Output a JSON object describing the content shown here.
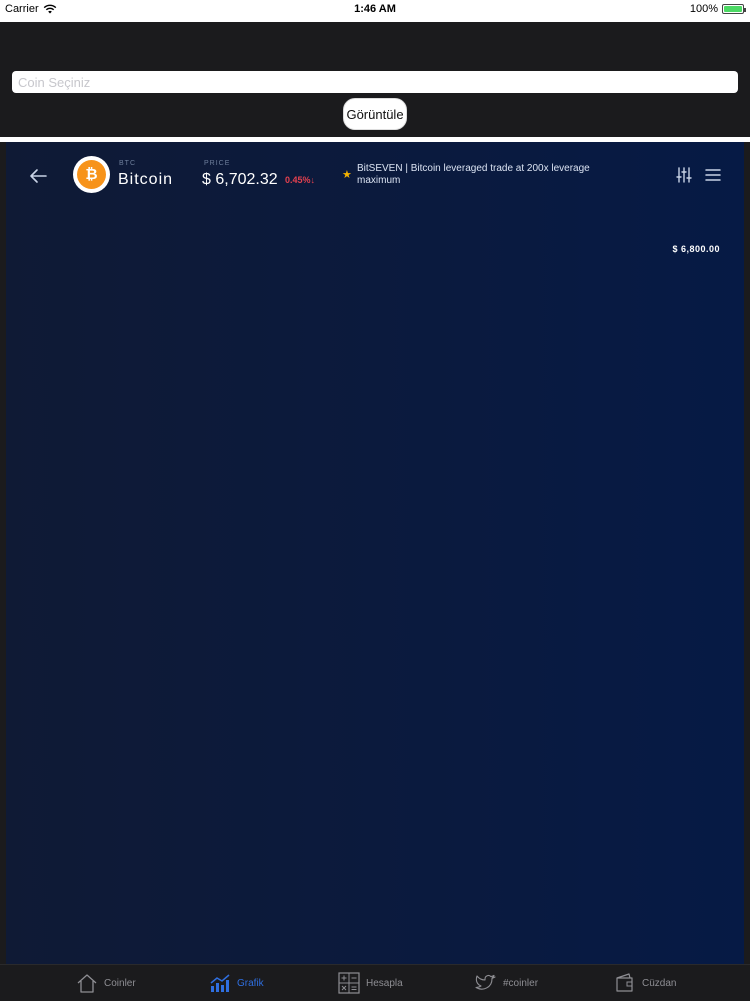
{
  "status_bar": {
    "carrier": "Carrier",
    "time": "1:46 AM",
    "battery": "100%"
  },
  "search": {
    "placeholder": "Coin Seçiniz",
    "button_label": "Görüntüle"
  },
  "chart_header": {
    "coin_symbol": "BTC",
    "coin_name": "Bitcoin",
    "price_label": "PRICE",
    "price_value": "$ 6,702.32",
    "price_change": "0.45%↓",
    "news": "BitSEVEN | Bitcoin leveraged trade at 200x leverage maximum"
  },
  "chart": {
    "price_axis_label": "$ 6,800.00"
  },
  "colors": {
    "accent": "#2f6fe0",
    "negative": "#e4414f",
    "bitcoin": "#f7931a",
    "star": "#f5b301"
  },
  "tabs": [
    {
      "label": "Coinler",
      "icon": "home-icon"
    },
    {
      "label": "Grafik",
      "icon": "chart-icon",
      "active": true
    },
    {
      "label": "Hesapla",
      "icon": "calculator-icon"
    },
    {
      "label": "#coinler",
      "icon": "twitter-icon"
    },
    {
      "label": "Cüzdan",
      "icon": "wallet-icon"
    }
  ]
}
